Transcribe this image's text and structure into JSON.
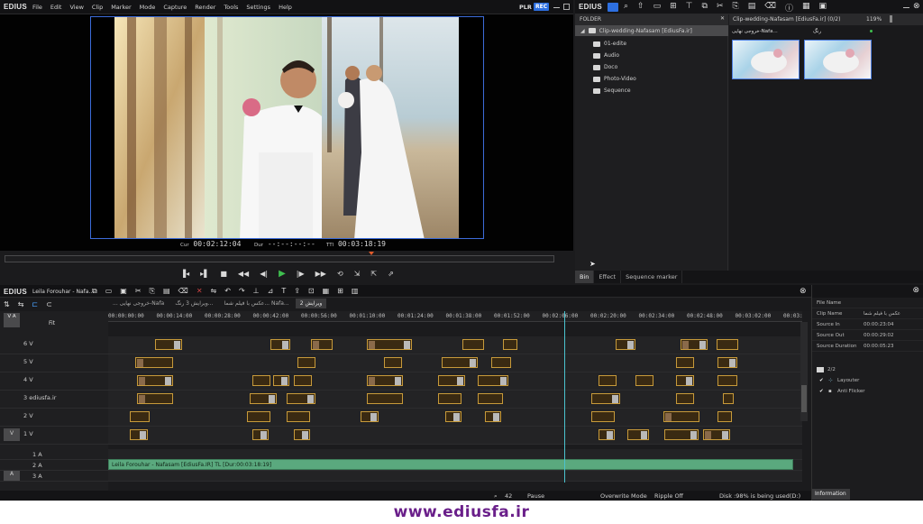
{
  "app": {
    "name": "EDIUS",
    "plr": "PLR",
    "rec": "REC"
  },
  "menu": [
    "File",
    "Edit",
    "View",
    "Clip",
    "Marker",
    "Mode",
    "Capture",
    "Render",
    "Tools",
    "Settings",
    "Help"
  ],
  "player": {
    "cur_label": "Cur",
    "cur": "00:02:12:04",
    "dur_label": "Dur",
    "dur": "--:--:--:--",
    "ttl_label": "TTl",
    "ttl": "00:03:18:19"
  },
  "bin": {
    "app_name": "EDIUS",
    "folder_header": "FOLDER",
    "root": "Clip-wedding-Nafasam [EdiusFa.ir]",
    "folders": [
      "01-edite",
      "Audio",
      "Doco",
      "Photo-Video",
      "Sequence"
    ],
    "bin_path": "Clip-wedding-Nafasam [EdiusFa.ir] (0/2)",
    "zoom": "119%",
    "clips": [
      {
        "name": "خروجی نهایی-Nafa..."
      },
      {
        "name": "رنگ"
      }
    ],
    "tabs": [
      "Bin",
      "Effect",
      "Sequence marker"
    ]
  },
  "timeline": {
    "app_name": "EDIUS",
    "project": "Leila Forouhar - Nafa...",
    "sequence_tabs": [
      "... خروجی نهایی-Nafa",
      "ویرایش 3 رنگ...",
      "عکس با فیلم شما... Nafa...",
      "ویرایش 2"
    ],
    "fit": "Fit",
    "ruler": [
      "00:00:00:00",
      "00:00:14:00",
      "00:00:28:00",
      "00:00:42:00",
      "00:00:56:00",
      "00:01:10:00",
      "00:01:24:00",
      "00:01:38:00",
      "00:01:52:00",
      "00:02:06:00",
      "00:02:20:00",
      "00:02:34:00",
      "00:02:48:00",
      "00:03:02:00",
      "00:03:"
    ],
    "tracks": [
      "6 V",
      "5 V",
      "4 V",
      "3 ediusfa.ir",
      "2 V",
      "1 V"
    ],
    "audio_tracks": [
      "1 A",
      "2 A",
      "3 A"
    ],
    "va_label": "V A",
    "v_label": "V",
    "a_label": "A",
    "audio_clip": "Leila Forouhar - Nafasam [EdiusFa.IR]  TL [Dur:00:03:18:19]",
    "status": {
      "zoom": "42",
      "state": "Pause",
      "mode": "Overwrite Mode",
      "ripple": "Ripple Off",
      "disk": "Disk :98% is being used(D:)"
    }
  },
  "info": {
    "rows": [
      {
        "label": "File Name",
        "value": ""
      },
      {
        "label": "Clip Name",
        "value": "عکس با فیلم شما"
      },
      {
        "label": "Source In",
        "value": "00:00:23:04"
      },
      {
        "label": "Source Out",
        "value": "00:00:29:02"
      },
      {
        "label": "Source Duration",
        "value": "00:00:05:23"
      }
    ],
    "count": "2/2",
    "effects": [
      "Layouter",
      "Anti Flicker"
    ],
    "tab": "Information"
  },
  "footer": "www.ediusfa.ir"
}
